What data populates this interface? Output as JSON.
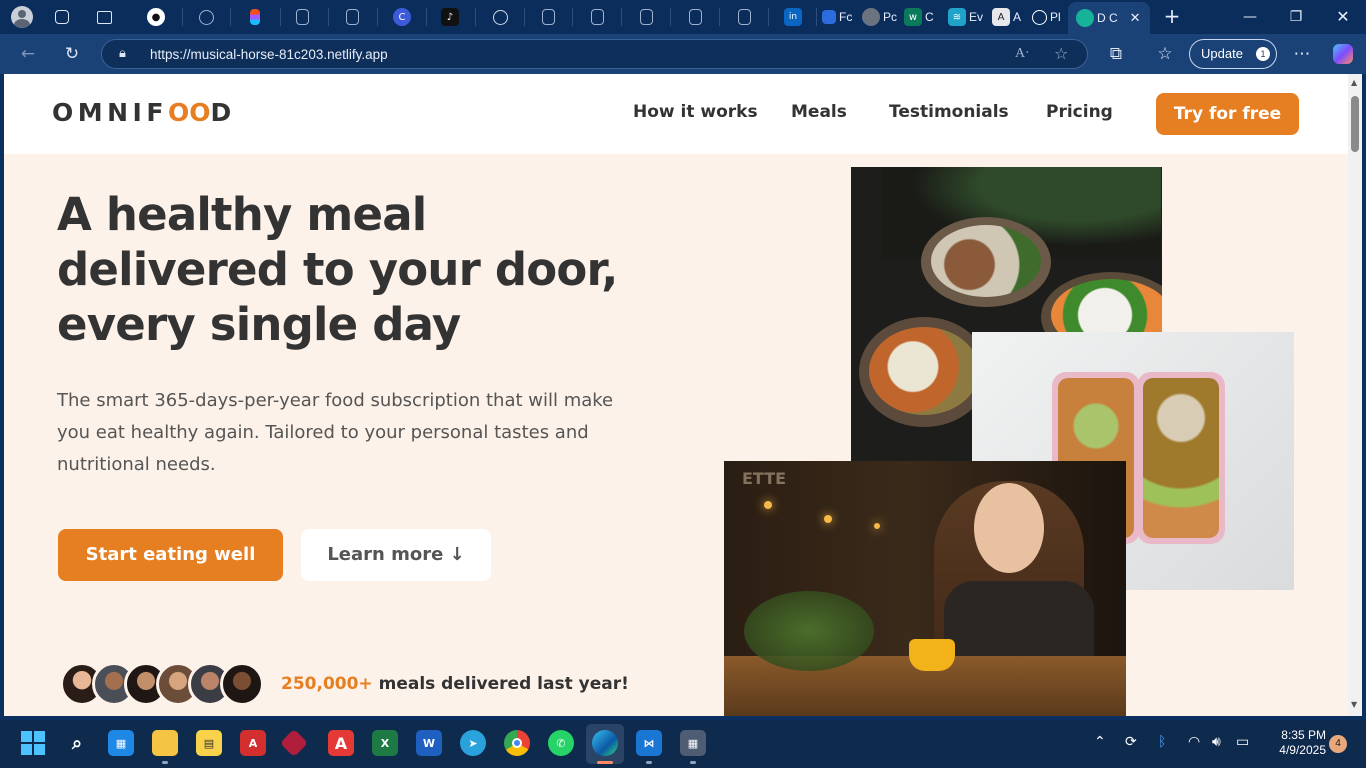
{
  "browser": {
    "active_tab_label": "D C",
    "other_tab_labels": [
      "Fc",
      "Pc",
      "C",
      "Ev",
      "A",
      "Pl"
    ],
    "url": "https://musical-horse-81c203.netlify.app",
    "update_label": "Update",
    "update_badge": "1"
  },
  "site": {
    "logo": {
      "prefix": "OMNIF",
      "mark": "OO",
      "suffix": "D"
    },
    "nav": [
      "How it works",
      "Meals",
      "Testimonials",
      "Pricing"
    ],
    "cta": "Try for free",
    "hero": {
      "title_lines": [
        "A healthy meal",
        "delivered to your door,",
        "every single day"
      ],
      "description": "The smart 365-days-per-year food subscription that will make you eat healthy again. Tailored to your personal tastes and nutritional needs.",
      "primary_button": "Start eating well",
      "secondary_button": "Learn more ↓",
      "delivered_number": "250,000+",
      "delivered_text": " meals delivered last year!"
    },
    "colors": {
      "accent": "#e67e22",
      "hero_bg": "#fdf2e9",
      "text": "#333333"
    }
  },
  "taskbar": {
    "time": "8:35 PM",
    "date": "4/9/2025",
    "notification_count": "4"
  }
}
